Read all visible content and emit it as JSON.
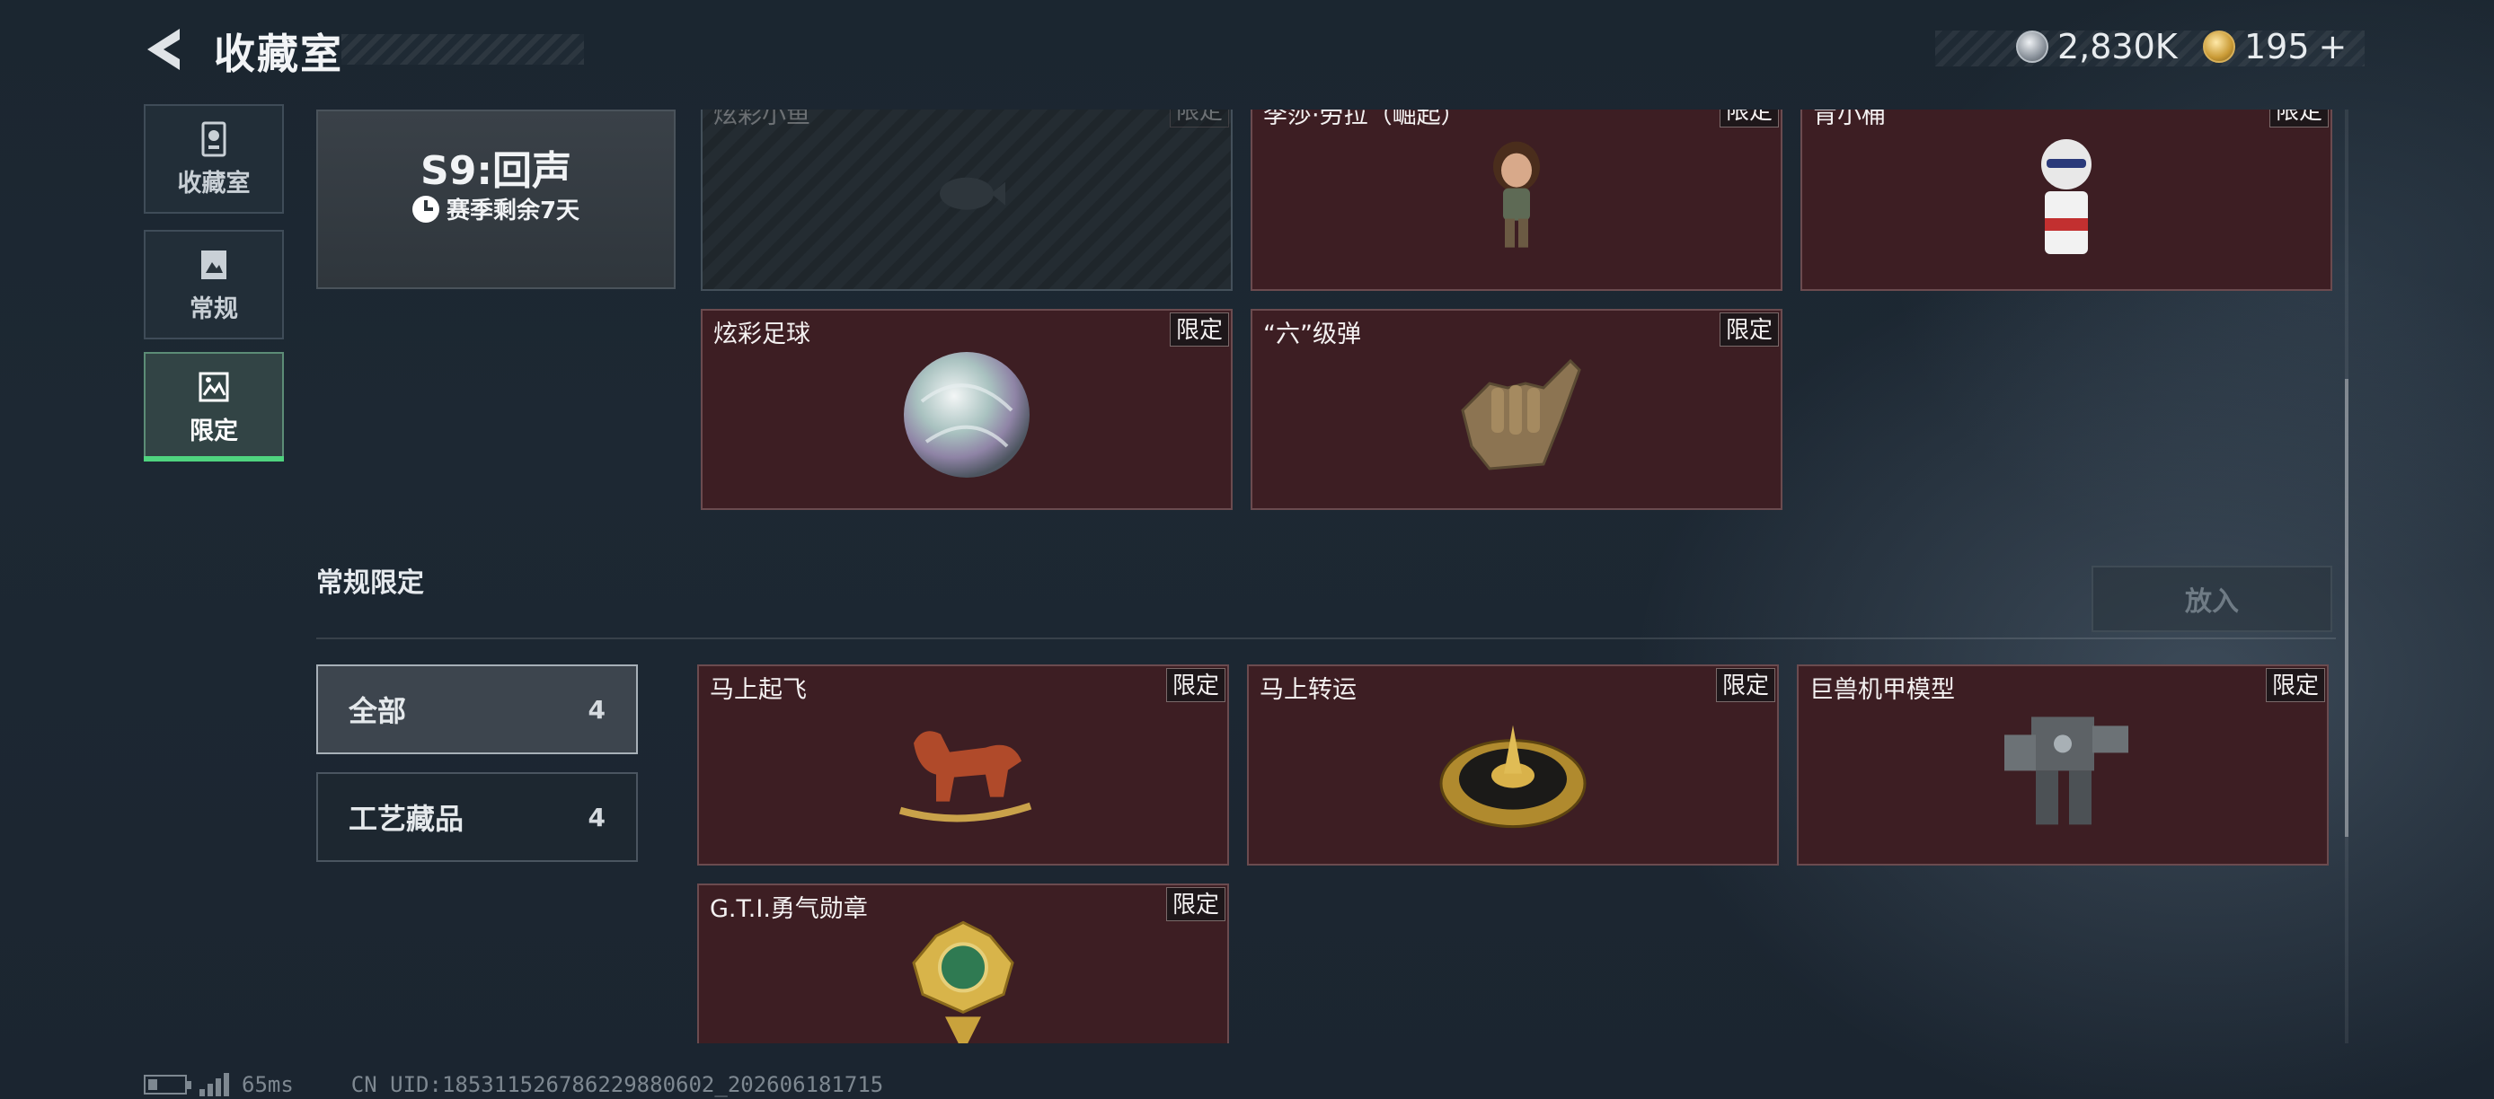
{
  "header": {
    "title": "收藏室",
    "currency": [
      {
        "icon": "silver-coin-icon",
        "value": "2,830K"
      },
      {
        "icon": "gold-coin-icon",
        "value": "195"
      }
    ],
    "add_symbol": "+"
  },
  "sidebar": {
    "items": [
      {
        "label": "收藏室",
        "icon": "trophy-cabinet-icon"
      },
      {
        "label": "常规",
        "icon": "picture-frame-icon"
      },
      {
        "label": "限定",
        "icon": "limited-picture-icon",
        "active": true
      }
    ]
  },
  "season": {
    "title": "S9:回声",
    "remaining": "赛季剩余7天"
  },
  "limited_items": [
    {
      "name": "炫彩小鱼",
      "tag": "限定",
      "locked": true
    },
    {
      "name": "李莎·劳拉（崛起）",
      "tag": "限定"
    },
    {
      "name": "肯小桶",
      "tag": "限定"
    },
    {
      "name": "炫彩足球",
      "tag": "限定"
    },
    {
      "name": "“六”级弹",
      "tag": "限定"
    }
  ],
  "regular_limited": {
    "title": "常规限定",
    "put_button": "放入",
    "filters": [
      {
        "label": "全部",
        "count": "4"
      },
      {
        "label": "工艺藏品",
        "count": "4"
      }
    ],
    "items": [
      {
        "name": "马上起飞",
        "tag": "限定"
      },
      {
        "name": "马上转运",
        "tag": "限定"
      },
      {
        "name": "巨兽机甲模型",
        "tag": "限定"
      },
      {
        "name": "G.T.I.勇气勋章",
        "tag": "限定"
      }
    ]
  },
  "status": {
    "ping": "65ms",
    "uid": "CN UID:18531152678622988060​2_202606181715"
  },
  "colors": {
    "card_bg": "#3d1e23",
    "active_accent": "#4fd47f",
    "page_bg": "#1d2833"
  }
}
